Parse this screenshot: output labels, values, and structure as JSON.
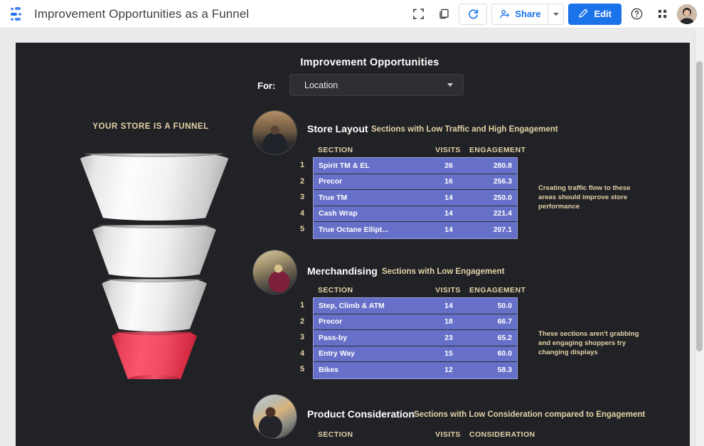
{
  "appbar": {
    "doc_title": "Improvement Opportunities as a Funnel",
    "logo_name": "looker-studio-logo",
    "fullscreen_label": "Fullscreen",
    "copy_label": "Make a copy",
    "refresh_label": "Refresh data",
    "share_label": "Share",
    "edit_label": "Edit",
    "help_label": "Help",
    "apps_label": "Google apps",
    "avatar_label": "Account"
  },
  "report": {
    "title": "Improvement Opportunities",
    "for_label": "For:",
    "filter": {
      "value": "Location",
      "options": [
        "Location"
      ]
    },
    "funnel_caption": "YOUR STORE IS A FUNNEL",
    "funnel_segments": [
      {
        "name": "segment-1",
        "color": "#f2f2f2"
      },
      {
        "name": "segment-2",
        "color": "#efefef"
      },
      {
        "name": "segment-3",
        "color": "#ececec"
      },
      {
        "name": "segment-4",
        "color": "#f04a62"
      }
    ],
    "sections": [
      {
        "title": "Store Layout",
        "subtitle": "Sections with Low Traffic and High Engagement",
        "note": "Creating traffic flow to these areas should improve store performance",
        "columns": [
          "SECTION",
          "VISITS",
          "ENGAGEMENT"
        ],
        "rows": [
          {
            "n": "1",
            "section": "Spirit TM & EL",
            "visits": "26",
            "value": "280.8"
          },
          {
            "n": "2",
            "section": "Precor",
            "visits": "16",
            "value": "256.3"
          },
          {
            "n": "3",
            "section": "True TM",
            "visits": "14",
            "value": "250.0"
          },
          {
            "n": "4",
            "section": "Cash Wrap",
            "visits": "14",
            "value": "221.4"
          },
          {
            "n": "5",
            "section": "True Octane Ellipt...",
            "visits": "14",
            "value": "207.1"
          }
        ]
      },
      {
        "title": "Merchandising",
        "subtitle": "Sections with Low Engagement",
        "note": "These sections aren't grabbing and engaging shoppers try changing displays",
        "columns": [
          "SECTION",
          "VISITS",
          "ENGAGEMENT"
        ],
        "rows": [
          {
            "n": "1",
            "section": "Step, Climb & ATM",
            "visits": "14",
            "value": "50.0"
          },
          {
            "n": "2",
            "section": "Precor",
            "visits": "18",
            "value": "66.7"
          },
          {
            "n": "3",
            "section": "Pass-by",
            "visits": "23",
            "value": "65.2"
          },
          {
            "n": "4",
            "section": "Entry Way",
            "visits": "15",
            "value": "60.0"
          },
          {
            "n": "5",
            "section": "Bikes",
            "visits": "12",
            "value": "58.3"
          }
        ]
      },
      {
        "title": "Product Consideration",
        "subtitle": "Sections with Low Consideration compared to Engagement",
        "note": "",
        "columns": [
          "SECTION",
          "VISITS",
          "CONSIDERATION"
        ],
        "rows": []
      }
    ]
  },
  "chart_data": {
    "type": "table",
    "title": "Improvement Opportunities",
    "tables": [
      {
        "name": "Store Layout",
        "subtitle": "Sections with Low Traffic and High Engagement",
        "columns": [
          "SECTION",
          "VISITS",
          "ENGAGEMENT"
        ],
        "rows": [
          [
            "Spirit TM & EL",
            26,
            280.8
          ],
          [
            "Precor",
            16,
            256.3
          ],
          [
            "True TM",
            14,
            250.0
          ],
          [
            "Cash Wrap",
            14,
            221.4
          ],
          [
            "True Octane Ellipt...",
            14,
            207.1
          ]
        ]
      },
      {
        "name": "Merchandising",
        "subtitle": "Sections with Low Engagement",
        "columns": [
          "SECTION",
          "VISITS",
          "ENGAGEMENT"
        ],
        "rows": [
          [
            "Step, Climb & ATM",
            14,
            50.0
          ],
          [
            "Precor",
            18,
            66.7
          ],
          [
            "Pass-by",
            23,
            65.2
          ],
          [
            "Entry Way",
            15,
            60.0
          ],
          [
            "Bikes",
            12,
            58.3
          ]
        ]
      },
      {
        "name": "Product Consideration",
        "subtitle": "Sections with Low Consideration compared to Engagement",
        "columns": [
          "SECTION",
          "VISITS",
          "CONSIDERATION"
        ],
        "rows": []
      }
    ],
    "funnel": {
      "type": "funnel",
      "label": "YOUR STORE IS A FUNNEL",
      "stages": 4,
      "highlight_stage": 4
    }
  }
}
